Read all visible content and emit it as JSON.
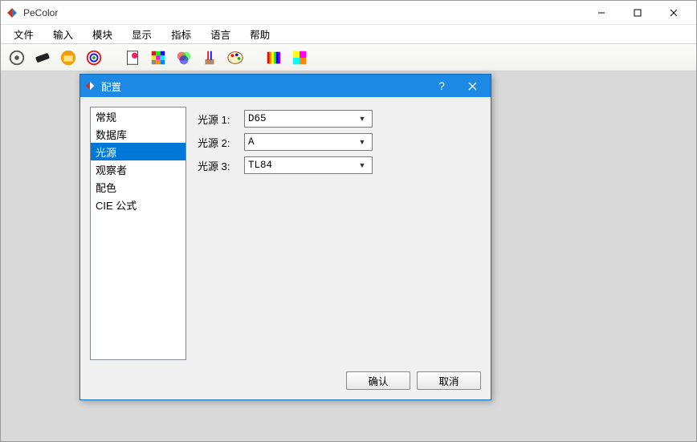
{
  "app": {
    "title": "PeColor"
  },
  "menu": {
    "file": "文件",
    "input": "输入",
    "module": "模块",
    "display": "显示",
    "indicator": "指标",
    "language": "语言",
    "help": "帮助"
  },
  "toolbar_icons": {
    "gear": "gear-icon",
    "ruler": "ruler-icon",
    "folder": "folder-icon",
    "reticle": "reticle-icon",
    "page": "page-icon",
    "grid": "grid-icon",
    "venn": "venn-icon",
    "tools": "tools-icon",
    "palette": "palette-icon",
    "spectrum": "spectrum-icon",
    "colorblock": "colorblock-icon"
  },
  "dialog": {
    "title": "配置",
    "list": {
      "general": "常规",
      "database": "数据库",
      "illuminant": "光源",
      "observer": "观察者",
      "colormatch": "配色",
      "cie": "CIE 公式"
    },
    "form": {
      "label1": "光源 1:",
      "label2": "光源 2:",
      "label3": "光源 3:",
      "value1": "D65",
      "value2": "A",
      "value3": "TL84"
    },
    "buttons": {
      "ok": "确认",
      "cancel": "取消"
    }
  }
}
